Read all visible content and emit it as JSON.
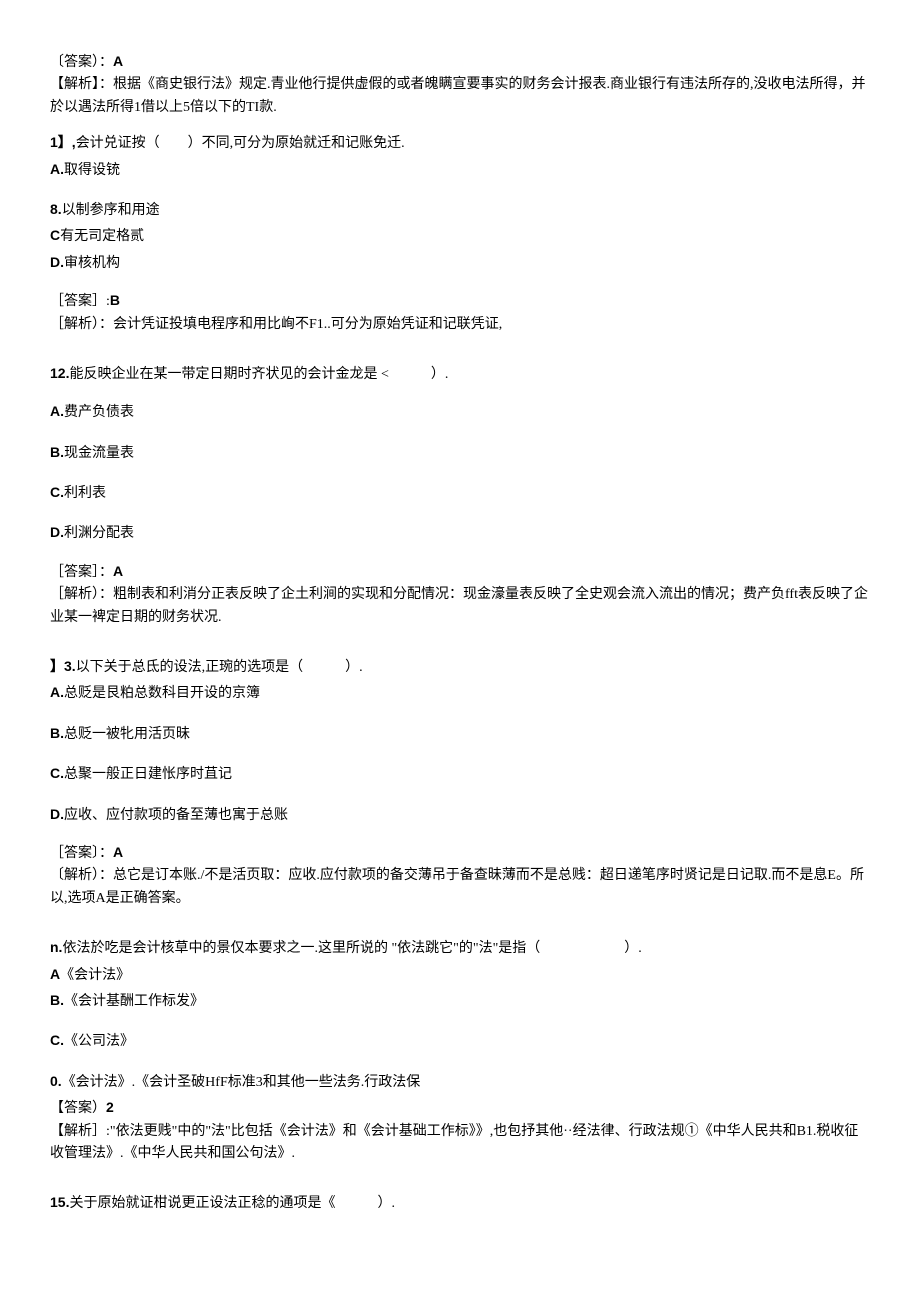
{
  "q10": {
    "answer_label": "〔答案）：",
    "answer_value": "A",
    "analysis_label": "【解析】：",
    "analysis_text": "根据《商史银行法》规定.青业他行提供虚假的或者魄瞒宣要事实的财务会计报表.商业银行有违法所存的,没收电法所得，并於以遇法所得1借以上5倍以下的TI款."
  },
  "q11": {
    "number": "1】,",
    "stem": "会计兑证按（　　）不同,可分为原始就迁和记账免迁.",
    "optA_label": "A.",
    "optA_text": "取得设铳",
    "optB_label": "8.",
    "optB_text": "以制参序和用途",
    "optC_label": "C",
    "optC_text": "有无司定格贰",
    "optD_label": "D.",
    "optD_text": "审核机构",
    "answer_label": "［答案］:",
    "answer_value": "B",
    "analysis_label": "［解析）：",
    "analysis_text": "会计凭证投填电程序和用比峋不F1..可分为原始凭证和记联凭证,"
  },
  "q12": {
    "number": "12.",
    "stem": "能反映企业在某一带定日期时齐状见的会计金龙是 <　　　）.",
    "optA_label": "A.",
    "optA_text": "费产负债表",
    "optB_label": "B.",
    "optB_text": "现金流量表",
    "optC_label": "C.",
    "optC_text": "利利表",
    "optD_label": "D.",
    "optD_text": "利渊分配表",
    "answer_label": "［答案］：",
    "answer_value": "A",
    "analysis_label": "［解析）：",
    "analysis_text": "粗制表和利消分正表反映了企土利涧的实现和分配情况：现金濠量表反映了全史观会流入流出的情况；费产负fft表反映了企业某一裨定日期的财务状况."
  },
  "q13": {
    "number": "】3.",
    "stem": "以下关于总氐的设法,正琬的选项是（　　　）.",
    "optA_label": "A.",
    "optA_text": "总贬是艮粕总数科目开设的京簿",
    "optB_label": "B.",
    "optB_text": "总贬一被牝用活页昧",
    "optC_label": "C.",
    "optC_text": "总聚一般正日建怅序时苴记",
    "optD_label": "D.",
    "optD_text": "应收、应付款项的备至薄也寓于总账",
    "answer_label": "［答案〕：",
    "answer_value": "A",
    "analysis_label": "〔解析）：",
    "analysis_text": "总它是订本账./不是活页取：应收.应付款项的备交薄吊于备查昧薄而不是总贱：超日递笔序时贤记是日记取.而不是息E。所以,选项A是正确答案。"
  },
  "q14": {
    "number": "n.",
    "stem": "依法於吃是会计核草中的景仅本要求之一.这里所说的 \"依法跳它\"的\"法\"是指（　　　　　　）.",
    "optA_label": "A",
    "optA_text": "《会计法》",
    "optB_label": "B.",
    "optB_text": "《会计基酬工作标发》",
    "optC_label": "C.",
    "optC_text": "《公司法》",
    "optD_label": "0.",
    "optD_text": "《会计法》.《会计圣破HfF标准3和其他一些法务.行政法保",
    "answer_label": "【答案）",
    "answer_value": "2",
    "analysis_label": "【解析］:",
    "analysis_text": "\"依法更贱\"中的\"法\"比包括《会计法》和《会计基础工作标》》,也包抒其他··经法律、行政法规①《中华人民共和B1.税收征收管理法》.《中华人民共和国公句法》."
  },
  "q15": {
    "number": "15.",
    "stem": "关于原始就证柑说更正设法正稔的通项是《　　　）."
  }
}
